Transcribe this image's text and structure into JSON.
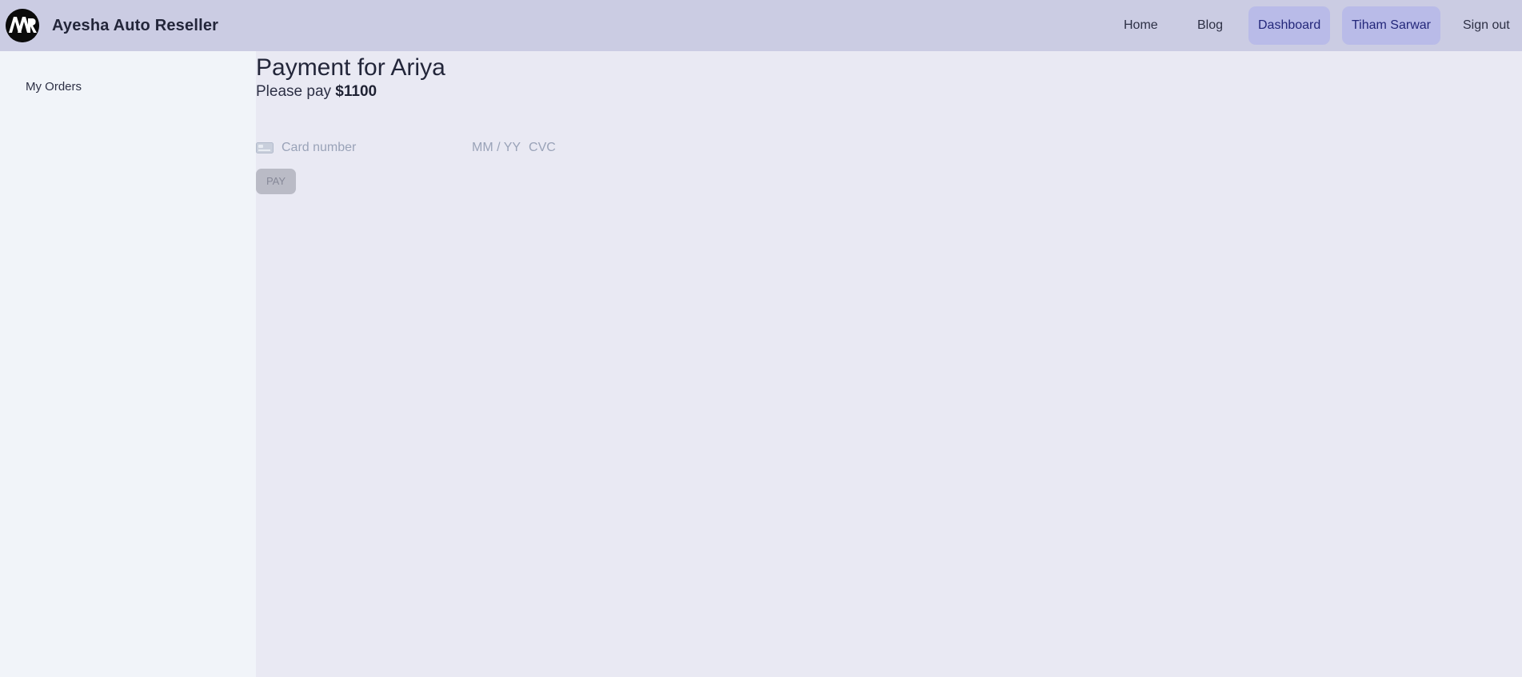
{
  "navbar": {
    "brand": "Ayesha Auto Reseller",
    "logo_text": "AAR",
    "items": [
      {
        "label": "Home"
      },
      {
        "label": "Blog"
      },
      {
        "label": "Dashboard",
        "active": true
      },
      {
        "label": "Tiham Sarwar",
        "active": true
      },
      {
        "label": "Sign out"
      }
    ],
    "active_bg": "#b9bbe8",
    "bar_bg": "#cbcce3"
  },
  "sidebar": {
    "items": [
      {
        "label": "My Orders"
      }
    ],
    "bg": "#f1f4f9"
  },
  "main": {
    "title": "Payment for Ariya",
    "pay_prefix": "Please pay ",
    "amount": "$1100",
    "card_form": {
      "card_icon": "credit-card-icon",
      "card_number_placeholder": "Card number",
      "expiry_placeholder": "MM / YY",
      "cvc_placeholder": "CVC"
    },
    "pay_button": "PAY",
    "bg": "#e9e9f3"
  }
}
